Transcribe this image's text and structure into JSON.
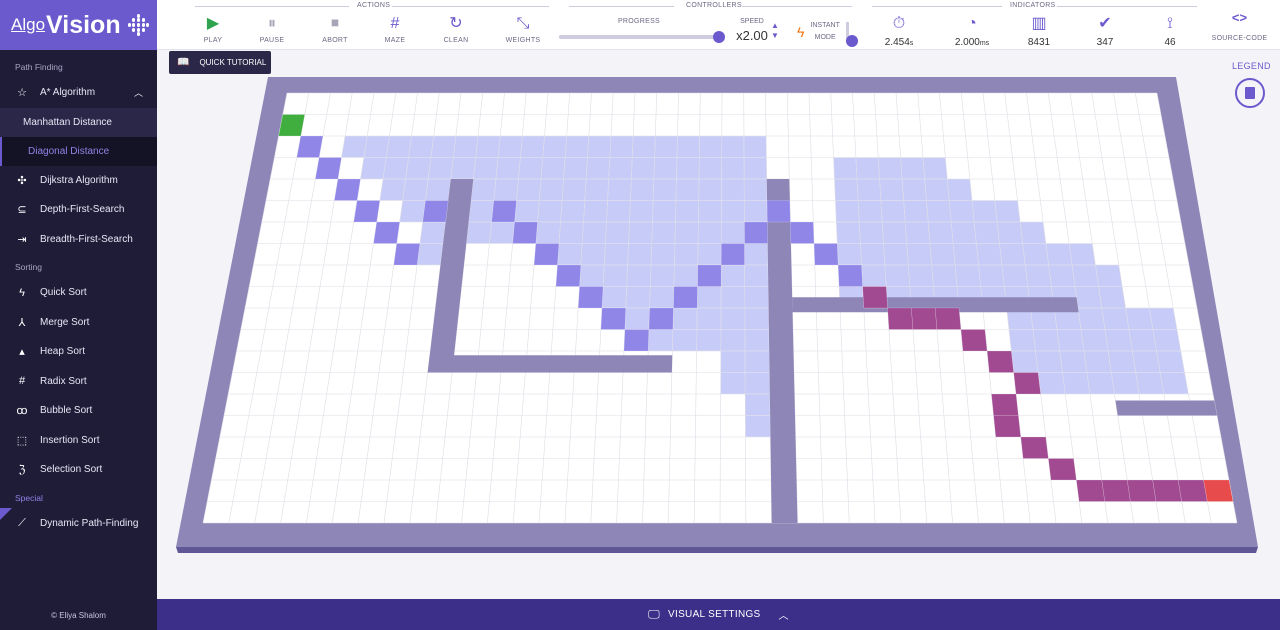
{
  "logo": {
    "algo": "Algo",
    "vision": "Vision"
  },
  "sidebar": {
    "path_section": "Path Finding",
    "astar": "A* Algorithm",
    "manhattan": "Manhattan Distance",
    "diagonal": "Diagonal Distance",
    "dijkstra": "Dijkstra Algorithm",
    "dfs": "Depth-First-Search",
    "bfs": "Breadth-First-Search",
    "sorting_section": "Sorting",
    "quick": "Quick Sort",
    "merge": "Merge Sort",
    "heap": "Heap Sort",
    "radix": "Radix Sort",
    "bubble": "Bubble Sort",
    "insertion": "Insertion Sort",
    "selection": "Selection Sort",
    "special_section": "Special",
    "dynamic": "Dynamic Path-Finding",
    "footer": "© Eliya Shalom"
  },
  "topbar": {
    "actions_label": "ACTIONS",
    "controllers_label": "CONTROLLERS",
    "indicators_label": "INDICATORS",
    "play": "PLAY",
    "pause": "PAUSE",
    "abort": "ABORT",
    "maze": "MAZE",
    "clean": "CLEAN",
    "weights": "WEIGHTS",
    "progress": "PROGRESS",
    "progress_value": 1.0,
    "speed_label": "SPEED",
    "speed_value": "x2.00",
    "instant_line1": "INSTANT",
    "instant_line2": "MODE",
    "ind_time": "2.454",
    "ind_time_unit": "s",
    "ind_delay": "2.000",
    "ind_delay_unit": "ms",
    "ind_visited": "8431",
    "ind_checked": "347",
    "ind_path": "46",
    "source_code": "SOURCE-CODE"
  },
  "tutorial": "QUICK TUTORIAL",
  "legend": "LEGEND",
  "visual_settings": "VISUAL SETTINGS",
  "colors": {
    "accent": "#6a5acd",
    "start": "#3fae3f",
    "end": "#e84b4b",
    "path": "#a14a92",
    "visited": "#c7cbf7",
    "frontier": "#8f86e8",
    "wall": "#8f86b8"
  },
  "icons": [
    "play-icon",
    "pause-icon",
    "abort-icon",
    "maze-icon",
    "clean-icon",
    "weights-icon",
    "stopwatch-icon",
    "speedometer-icon",
    "bar-chart-icon",
    "check-circle-icon",
    "path-icon",
    "code-icon"
  ]
}
